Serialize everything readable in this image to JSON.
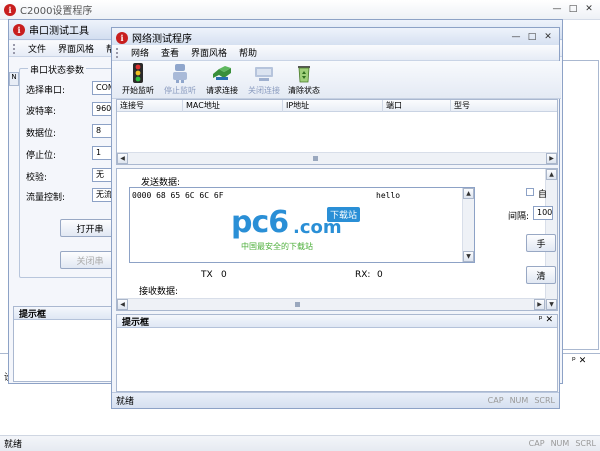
{
  "main_window": {
    "title": "C2000设置程序",
    "status": "就绪",
    "indicators": [
      "CAP",
      "NUM",
      "SCRL"
    ],
    "bg_label": "提示框",
    "bg_text": "设"
  },
  "serial_window": {
    "title": "串口测试工具",
    "menu": [
      "文件",
      "界面风格",
      "帮助"
    ],
    "group_title": "串口状态参数",
    "fields": [
      {
        "label": "选择串口:",
        "value": "COM1"
      },
      {
        "label": "波特率:",
        "value": "9600"
      },
      {
        "label": "数据位:",
        "value": "8"
      },
      {
        "label": "停止位:",
        "value": "1"
      },
      {
        "label": "校验:",
        "value": "无"
      },
      {
        "label": "流量控制:",
        "value": "无流"
      }
    ],
    "open_button": "打开串",
    "close_button": "关闭串",
    "tip_title": "提示框"
  },
  "net_window": {
    "title": "网络测试程序",
    "menu": [
      "网络",
      "查看",
      "界面风格",
      "帮助"
    ],
    "toolbar": [
      {
        "label": "开始监听",
        "icon": "traffic-light-icon",
        "enabled": true
      },
      {
        "label": "停止监听",
        "icon": "robot-icon",
        "enabled": false
      },
      {
        "label": "请求连接",
        "icon": "handshake-icon",
        "enabled": true
      },
      {
        "label": "关闭连接",
        "icon": "disconnect-icon",
        "enabled": false
      },
      {
        "label": "清除状态",
        "icon": "recycle-bin-icon",
        "enabled": true
      }
    ],
    "table_headers": [
      "连接号",
      "MAC地址",
      "IP地址",
      "端口",
      "型号"
    ],
    "send_label": "发送数据:",
    "send_hex": "0000 68 65 6C 6C 6F",
    "send_ascii": "hello",
    "tx_label": "TX",
    "tx_value": "0",
    "rx_label": "RX:",
    "rx_value": "0",
    "recv_label": "接收数据:",
    "auto_label": "自",
    "interval_label": "间隔:",
    "interval_value": "100",
    "manual_button": "手",
    "clear_button": "清",
    "tip_title": "提示框",
    "status": "就绪",
    "indicators": [
      "CAP",
      "NUM",
      "SCRL"
    ]
  },
  "watermark": {
    "brand": "pc6",
    "dotcom": ".com",
    "badge": "下载站",
    "tagline": "中国最安全的下载站"
  },
  "colors": {
    "accent": "#2a8fd6",
    "watermark_green": "#4caf3a",
    "icon_red": "#c81e1e"
  }
}
